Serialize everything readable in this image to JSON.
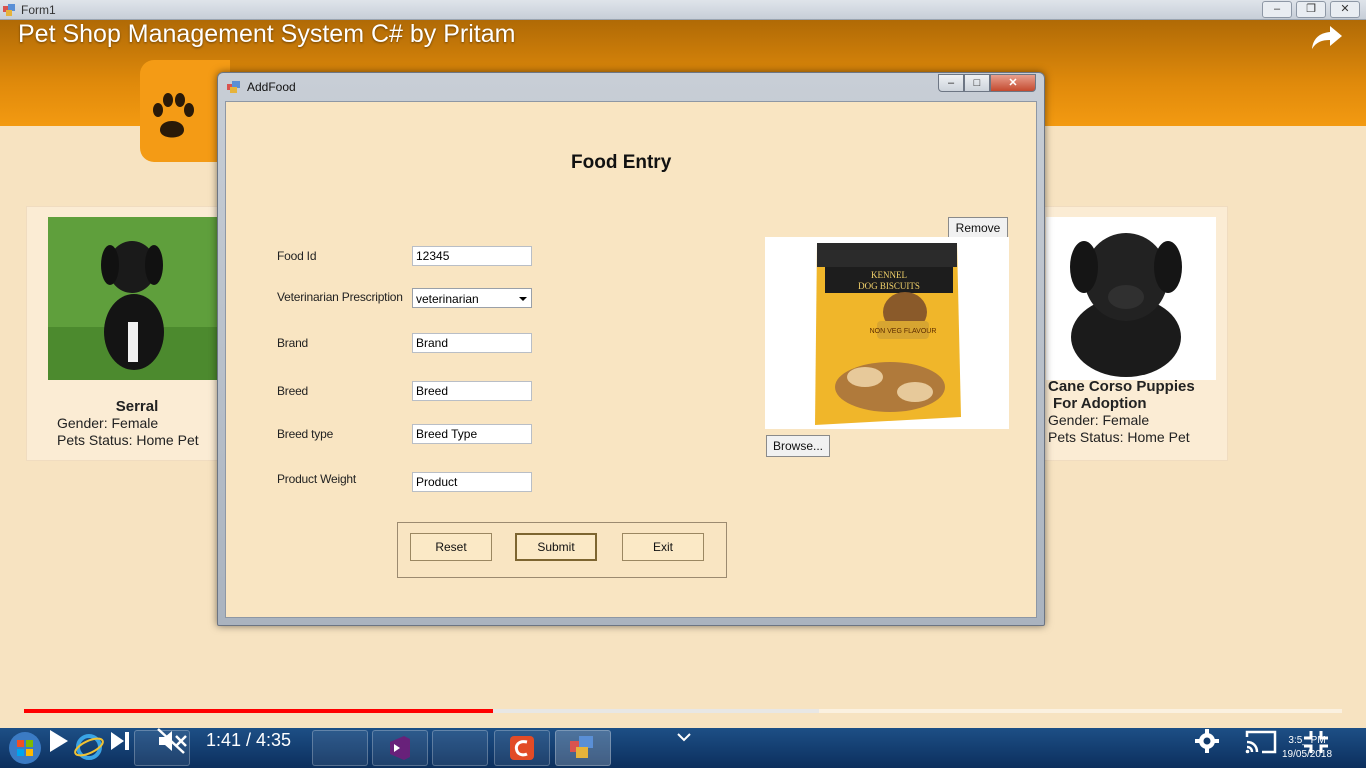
{
  "outer_window": {
    "title": "Form1"
  },
  "video": {
    "title": "Pet Shop Management System C# by Pritam",
    "time": "1:41 / 4:35",
    "progress_fraction": 0.356,
    "buffered_fraction": 0.603
  },
  "pets": [
    {
      "name": "Serral",
      "gender": "Gender: Female",
      "status": "Pets Status: Home Pet"
    },
    {
      "name": "Cane Corso Puppies",
      "name2": "For Adoption",
      "gender": "Gender: Female",
      "status": "Pets Status: Home Pet"
    }
  ],
  "dialog": {
    "title": "AddFood",
    "heading": "Food Entry",
    "fields": {
      "food_id": {
        "label": "Food Id",
        "value": "12345"
      },
      "prescription": {
        "label": "Veterinarian Prescription",
        "value": "veterinarian"
      },
      "brand": {
        "label": "Brand",
        "value": "Brand"
      },
      "breed": {
        "label": "Breed",
        "value": "Breed"
      },
      "breed_type": {
        "label": "Breed type",
        "value": "Breed Type"
      },
      "weight": {
        "label": "Product Weight",
        "value": "Product"
      }
    },
    "buttons": {
      "reset": "Reset",
      "submit": "Submit",
      "exit": "Exit",
      "remove": "Remove",
      "browse": "Browse..."
    },
    "product_image": {
      "text1": "KENNEL",
      "text2": "DOG BISCUITS",
      "text3": "NON VEG FLAVOUR"
    }
  },
  "clock": {
    "time": "3:5_ PM",
    "date": "19/05/2018"
  },
  "icons": [
    "windows-start-icon",
    "play-icon",
    "next-icon",
    "mute-icon",
    "settings-icon",
    "cast-icon",
    "fullscreen-exit-icon",
    "share-icon",
    "chevron-down-icon"
  ],
  "colors": {
    "header": "#e08a0b",
    "dialog_bg": "#f9e5c2",
    "progress": "#ff0000",
    "taskbar": "#0c2f5d"
  }
}
